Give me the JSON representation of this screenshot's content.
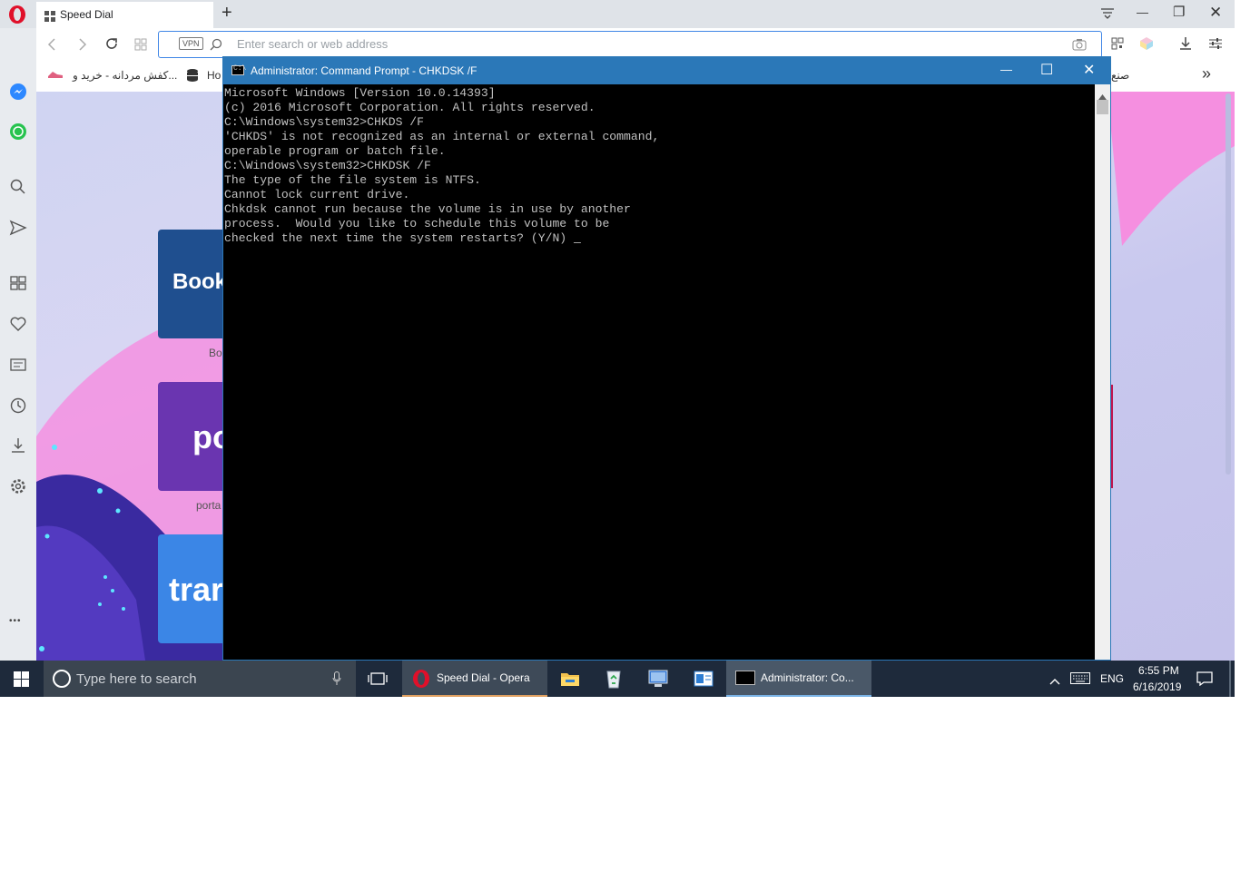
{
  "browser": {
    "tab_title": "Speed Dial",
    "new_tab": "+",
    "address_placeholder": "Enter search or web address",
    "vpn_badge": "VPN",
    "bookmarks": [
      {
        "label": "كفش مردانه - خرید و..."
      },
      {
        "label": "Ho"
      }
    ],
    "bookmark_right_label": "صنع",
    "more_bookmarks": "»",
    "window_controls": {
      "minimize": "—",
      "maximize": "❐",
      "close": "✕"
    },
    "sidebar_more": "•••"
  },
  "speed_dial": {
    "tiles": [
      {
        "text": "Book",
        "caption": "Bo",
        "color": "#1f4f8f"
      },
      {
        "text": "po",
        "caption": "porta",
        "color": "#6a35b0"
      },
      {
        "text": "trar",
        "caption": "",
        "color": "#3b86e6"
      }
    ]
  },
  "cmd": {
    "title": "Administrator: Command Prompt - CHKDSK  /F",
    "lines": [
      "Microsoft Windows [Version 10.0.14393]",
      "(c) 2016 Microsoft Corporation. All rights reserved.",
      "",
      "C:\\Windows\\system32>CHKDS /F",
      "'CHKDS' is not recognized as an internal or external command,",
      "operable program or batch file.",
      "",
      "C:\\Windows\\system32>CHKDSK /F",
      "The type of the file system is NTFS.",
      "Cannot lock current drive.",
      "",
      "Chkdsk cannot run because the volume is in use by another",
      "process.  Would you like to schedule this volume to be",
      "checked the next time the system restarts? (Y/N) "
    ],
    "cursor": "_",
    "controls": {
      "minimize": "—",
      "maximize": "☐",
      "close": "✕"
    }
  },
  "taskbar": {
    "search_placeholder": "Type here to search",
    "apps": [
      {
        "label": "Speed Dial - Opera"
      },
      {
        "label": "Administrator: Co..."
      }
    ],
    "language": "ENG",
    "time": "6:55 PM",
    "date": "6/16/2019"
  }
}
